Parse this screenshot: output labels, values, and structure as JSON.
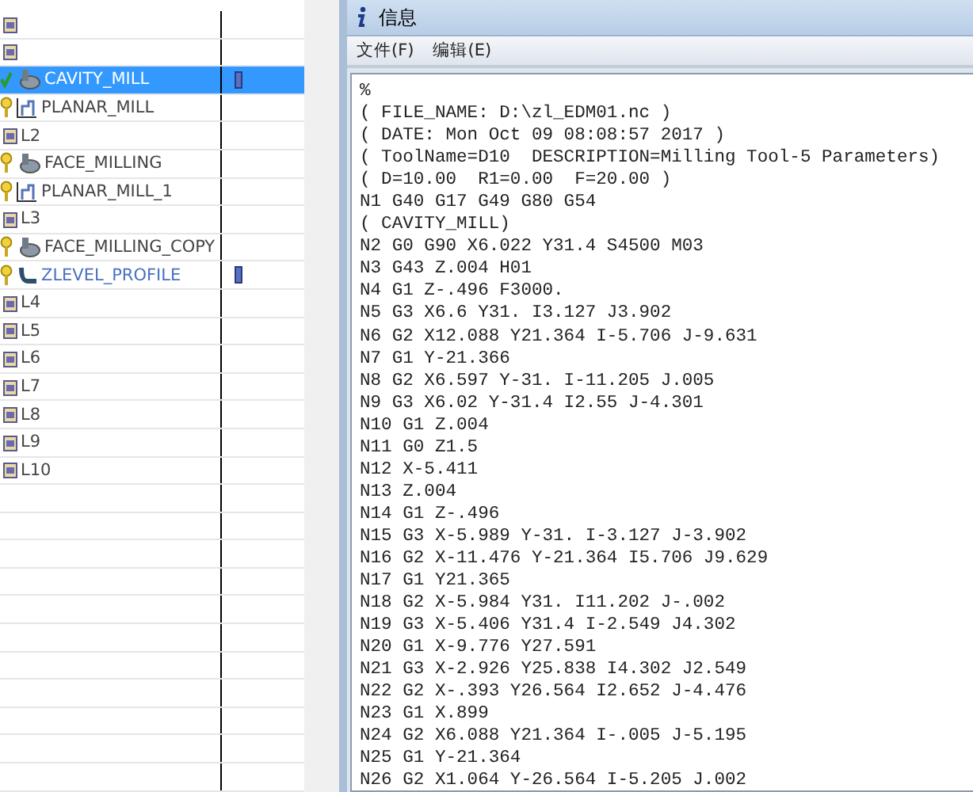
{
  "tree": {
    "rows": [
      {
        "kind": "group",
        "selected": false,
        "marker": false
      },
      {
        "kind": "group",
        "selected": false,
        "marker": false
      },
      {
        "kind": "cavity",
        "label": "CAVITY_MILL",
        "done": true,
        "selected": true,
        "marker": true
      },
      {
        "kind": "planar",
        "label": "PLANAR_MILL",
        "done": false,
        "selected": false,
        "marker": false
      },
      {
        "kind": "group",
        "label": "L2",
        "selected": false,
        "marker": false
      },
      {
        "kind": "face",
        "label": "FACE_MILLING",
        "done": false,
        "selected": false,
        "marker": false
      },
      {
        "kind": "planar",
        "label": "PLANAR_MILL_1",
        "done": false,
        "selected": false,
        "marker": false
      },
      {
        "kind": "group",
        "label": "L3",
        "selected": false,
        "marker": false
      },
      {
        "kind": "face",
        "label": "FACE_MILLING_COPY",
        "done": false,
        "selected": false,
        "marker": false
      },
      {
        "kind": "zlevel",
        "label": "ZLEVEL_PROFILE",
        "done": false,
        "selected": false,
        "marker": true,
        "color": "#4a70c0"
      },
      {
        "kind": "group",
        "label": "L4",
        "selected": false,
        "marker": false
      },
      {
        "kind": "group",
        "label": "L5",
        "selected": false,
        "marker": false
      },
      {
        "kind": "group",
        "label": "L6",
        "selected": false,
        "marker": false
      },
      {
        "kind": "group",
        "label": "L7",
        "selected": false,
        "marker": false
      },
      {
        "kind": "group",
        "label": "L8",
        "selected": false,
        "marker": false
      },
      {
        "kind": "group",
        "label": "L9",
        "selected": false,
        "marker": false
      },
      {
        "kind": "group",
        "label": "L10",
        "selected": false,
        "marker": false
      }
    ]
  },
  "window": {
    "title": "信息",
    "menu": [
      "文件(F)",
      "编辑(E)"
    ],
    "lines": [
      "%",
      "( FILE_NAME: D:\\zl_EDM01.nc )",
      "( DATE: Mon Oct 09 08:08:57 2017 )",
      "( ToolName=D10  DESCRIPTION=Milling Tool-5 Parameters)",
      "( D=10.00  R1=0.00  F=20.00 )",
      "N1 G40 G17 G49 G80 G54",
      "( CAVITY_MILL)",
      "N2 G0 G90 X6.022 Y31.4 S4500 M03",
      "N3 G43 Z.004 H01",
      "N4 G1 Z-.496 F3000.",
      "N5 G3 X6.6 Y31. I3.127 J3.902",
      "N6 G2 X12.088 Y21.364 I-5.706 J-9.631",
      "N7 G1 Y-21.366",
      "N8 G2 X6.597 Y-31. I-11.205 J.005",
      "N9 G3 X6.02 Y-31.4 I2.55 J-4.301",
      "N10 G1 Z.004",
      "N11 G0 Z1.5",
      "N12 X-5.411",
      "N13 Z.004",
      "N14 G1 Z-.496",
      "N15 G3 X-5.989 Y-31. I-3.127 J-3.902",
      "N16 G2 X-11.476 Y-21.364 I5.706 J9.629",
      "N17 G1 Y21.365",
      "N18 G2 X-5.984 Y31. I11.202 J-.002",
      "N19 G3 X-5.406 Y31.4 I-2.549 J4.302",
      "N20 G1 X-9.776 Y27.591",
      "N21 G3 X-2.926 Y25.838 I4.302 J2.549",
      "N22 G2 X-.393 Y26.564 I2.652 J-4.476",
      "N23 G1 X.899",
      "N24 G2 X6.088 Y21.364 I-.005 J-5.195",
      "N25 G1 Y-21.364",
      "N26 G2 X1.064 Y-26.564 I-5.205 J.002"
    ]
  }
}
